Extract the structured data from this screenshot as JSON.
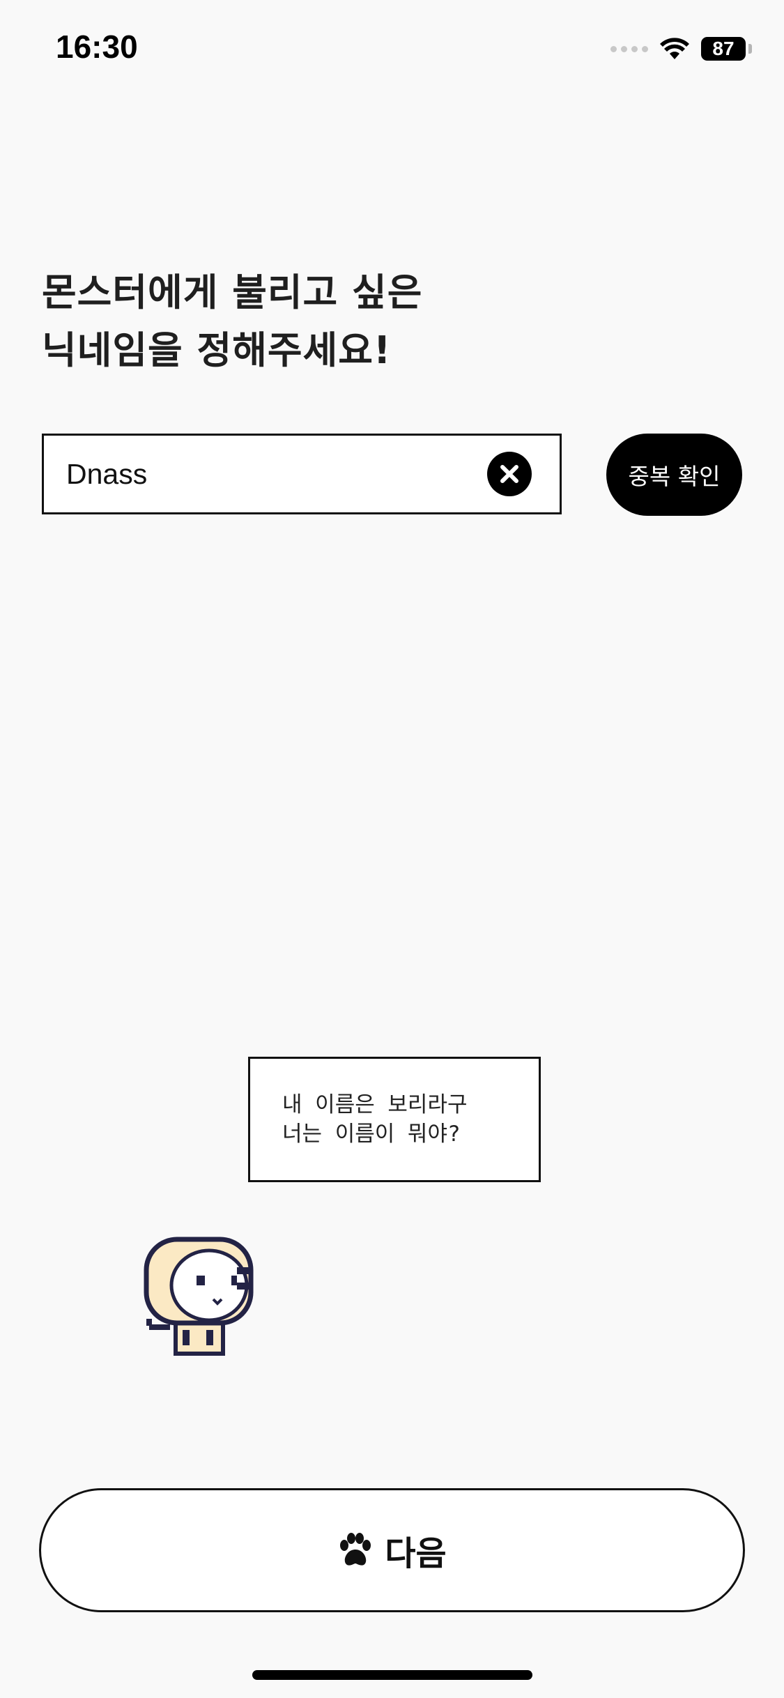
{
  "status_bar": {
    "time": "16:30",
    "battery": "87",
    "icons": [
      "signal-icon",
      "wifi-icon",
      "battery-icon"
    ]
  },
  "title": {
    "line1": "몬스터에게 불리고 싶은",
    "line2": "닉네임을 정해주세요!"
  },
  "nickname_input": {
    "value": "Dnass",
    "clear_icon": "close-circle-icon"
  },
  "duplicate_check_button": {
    "label": "중복 확인"
  },
  "speech_bubble": {
    "line1": "내 이름은 보리라구",
    "line2": "너는 이름이 뭐야?"
  },
  "mascot": {
    "icon": "pixel-monster-icon"
  },
  "next_button": {
    "label": "다음",
    "icon": "paw-icon"
  },
  "colors": {
    "background": "#f9f9f9",
    "primary": "#000000",
    "mascot_fill": "#fbe9c4",
    "mascot_outline": "#232345"
  }
}
